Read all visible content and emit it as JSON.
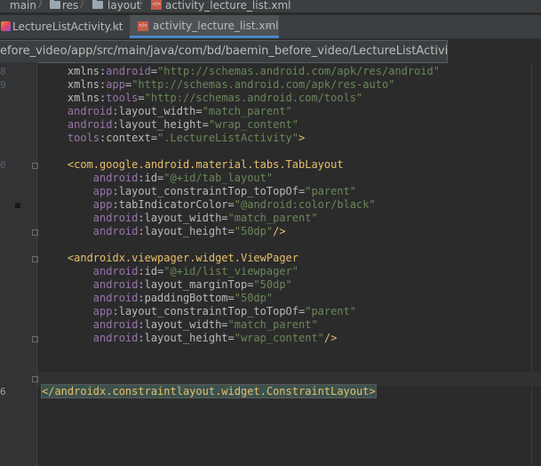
{
  "breadcrumb": {
    "items": [
      {
        "label": "main",
        "icon": "folder-icon"
      },
      {
        "label": "res",
        "icon": "folder-icon"
      },
      {
        "label": "layout",
        "icon": "folder-icon"
      },
      {
        "label": "activity_lecture_list.xml",
        "icon": "xml-file-icon"
      }
    ],
    "separator": "〉"
  },
  "tabs": [
    {
      "label": "LectureListActivity.kt",
      "icon": "kotlin-file-icon",
      "active": false
    },
    {
      "label": "activity_lecture_list.xml",
      "icon": "xml-file-icon",
      "active": true
    }
  ],
  "tab_close_glyph": "×",
  "tooltip": {
    "path": "efore_video/app/src/main/java/com/bd/baemin_before_video/LectureListActivity.kt"
  },
  "gutter": {
    "line_numbers": [
      "8",
      "9",
      "",
      "",
      "",
      "",
      "",
      "0",
      "",
      "",
      "",
      "",
      "",
      "",
      "",
      "",
      "",
      "",
      "",
      "",
      "",
      "",
      "",
      "",
      "6"
    ]
  },
  "editor": {
    "lines": [
      [
        {
          "t": "    "
        },
        {
          "t": "xmlns:",
          "c": "attr"
        },
        {
          "t": "android",
          "c": "ns"
        },
        {
          "t": "=",
          "c": "attr"
        },
        {
          "t": "\"http://schemas.android.com/apk/res/android\"",
          "c": "val"
        }
      ],
      [
        {
          "t": "    "
        },
        {
          "t": "xmlns:",
          "c": "attr"
        },
        {
          "t": "app",
          "c": "ns"
        },
        {
          "t": "=",
          "c": "attr"
        },
        {
          "t": "\"http://schemas.android.com/apk/res-auto\"",
          "c": "val"
        }
      ],
      [
        {
          "t": "    "
        },
        {
          "t": "xmlns:",
          "c": "attr"
        },
        {
          "t": "tools",
          "c": "ns"
        },
        {
          "t": "=",
          "c": "attr"
        },
        {
          "t": "\"http://schemas.android.com/tools\"",
          "c": "val"
        }
      ],
      [
        {
          "t": "    "
        },
        {
          "t": "android",
          "c": "ns"
        },
        {
          "t": ":layout_width=",
          "c": "attr"
        },
        {
          "t": "\"match_parent\"",
          "c": "val"
        }
      ],
      [
        {
          "t": "    "
        },
        {
          "t": "android",
          "c": "ns"
        },
        {
          "t": ":layout_height=",
          "c": "attr"
        },
        {
          "t": "\"wrap_content\"",
          "c": "val"
        }
      ],
      [
        {
          "t": "    "
        },
        {
          "t": "tools",
          "c": "ns"
        },
        {
          "t": ":context=",
          "c": "attr"
        },
        {
          "t": "\".LectureListActivity\"",
          "c": "val"
        },
        {
          "t": ">",
          "c": "tag"
        }
      ],
      [
        {
          "t": ""
        }
      ],
      [
        {
          "t": "    "
        },
        {
          "t": "<com.google.android.material.tabs.TabLayout",
          "c": "tag"
        }
      ],
      [
        {
          "t": "        "
        },
        {
          "t": "android",
          "c": "ns"
        },
        {
          "t": ":id=",
          "c": "attr"
        },
        {
          "t": "\"@+id/tab_layout\"",
          "c": "val"
        }
      ],
      [
        {
          "t": "        "
        },
        {
          "t": "app",
          "c": "ns"
        },
        {
          "t": ":layout_constraintTop_toTopOf=",
          "c": "attr"
        },
        {
          "t": "\"parent\"",
          "c": "val"
        }
      ],
      [
        {
          "t": "        "
        },
        {
          "t": "app",
          "c": "ns"
        },
        {
          "t": ":tabIndicatorColor=",
          "c": "attr"
        },
        {
          "t": "\"@android:color/black\"",
          "c": "val"
        }
      ],
      [
        {
          "t": "        "
        },
        {
          "t": "android",
          "c": "ns"
        },
        {
          "t": ":layout_width=",
          "c": "attr"
        },
        {
          "t": "\"match_parent\"",
          "c": "val"
        }
      ],
      [
        {
          "t": "        "
        },
        {
          "t": "android",
          "c": "ns"
        },
        {
          "t": ":layout_height=",
          "c": "attr"
        },
        {
          "t": "\"50dp\"",
          "c": "val"
        },
        {
          "t": "/>",
          "c": "tag"
        }
      ],
      [
        {
          "t": ""
        }
      ],
      [
        {
          "t": "    "
        },
        {
          "t": "<androidx.viewpager.widget.ViewPager",
          "c": "tag"
        }
      ],
      [
        {
          "t": "        "
        },
        {
          "t": "android",
          "c": "ns"
        },
        {
          "t": ":id=",
          "c": "attr"
        },
        {
          "t": "\"@+id/list_viewpager\"",
          "c": "val"
        }
      ],
      [
        {
          "t": "        "
        },
        {
          "t": "android",
          "c": "ns"
        },
        {
          "t": ":layout_marginTop=",
          "c": "attr"
        },
        {
          "t": "\"50dp\"",
          "c": "val"
        }
      ],
      [
        {
          "t": "        "
        },
        {
          "t": "android",
          "c": "ns"
        },
        {
          "t": ":paddingBottom=",
          "c": "attr"
        },
        {
          "t": "\"50dp\"",
          "c": "val"
        }
      ],
      [
        {
          "t": "        "
        },
        {
          "t": "app",
          "c": "ns"
        },
        {
          "t": ":layout_constraintTop_toTopOf=",
          "c": "attr"
        },
        {
          "t": "\"parent\"",
          "c": "val"
        }
      ],
      [
        {
          "t": "        "
        },
        {
          "t": "android",
          "c": "ns"
        },
        {
          "t": ":layout_width=",
          "c": "attr"
        },
        {
          "t": "\"match_parent\"",
          "c": "val"
        }
      ],
      [
        {
          "t": "        "
        },
        {
          "t": "android",
          "c": "ns"
        },
        {
          "t": ":layout_height=",
          "c": "attr"
        },
        {
          "t": "\"wrap_content\"",
          "c": "val"
        },
        {
          "t": "/>",
          "c": "tag"
        }
      ],
      [
        {
          "t": ""
        }
      ],
      [
        {
          "t": ""
        }
      ],
      [
        {
          "t": ""
        }
      ],
      [
        {
          "t": "</androidx.constraintlayout.widget.ConstraintLayout>",
          "c": "tag",
          "caret": true
        }
      ]
    ]
  }
}
